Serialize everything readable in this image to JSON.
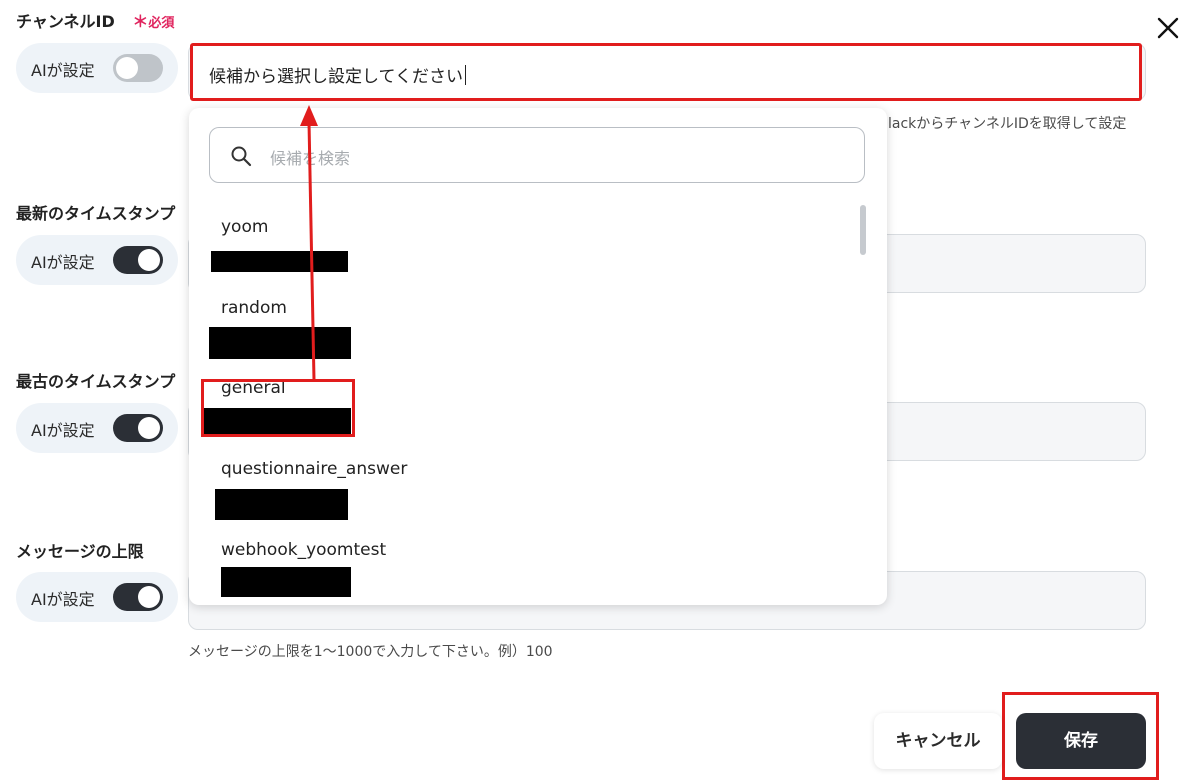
{
  "form": {
    "channel": {
      "label": "チャンネルID",
      "required_star": "＊",
      "required_text": "必須",
      "ai_label": "AIが設定",
      "ai_toggle": "off",
      "value": "候補から選択し設定してください",
      "hint": "lackからチャンネルIDを取得して設定"
    },
    "latest": {
      "label": "最新のタイムスタンプ",
      "ai_label": "AIが設定",
      "ai_toggle": "on"
    },
    "oldest": {
      "label": "最古のタイムスタンプ",
      "ai_label": "AIが設定",
      "ai_toggle": "on"
    },
    "limit": {
      "label": "メッセージの上限",
      "ai_label": "AIが設定",
      "ai_toggle": "on",
      "hint": "メッセージの上限を1〜1000で入力して下さい。例）100"
    }
  },
  "dropdown": {
    "search_placeholder": "候補を検索",
    "options": [
      {
        "name": "yoom"
      },
      {
        "name": "random"
      },
      {
        "name": "general"
      },
      {
        "name": "questionnaire_answer"
      },
      {
        "name": "webhook_yoomtest"
      }
    ]
  },
  "buttons": {
    "cancel": "キャンセル",
    "save": "保存"
  },
  "colors": {
    "accent_dark": "#2b2f36",
    "highlight_red": "#e11d1d",
    "required_pink": "#e0245e"
  }
}
